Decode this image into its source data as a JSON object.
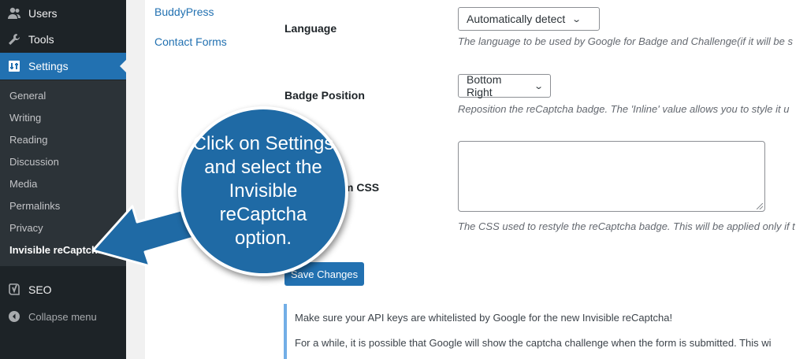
{
  "sidebar": {
    "top_items": [
      {
        "label": "Users",
        "icon": "users-icon"
      },
      {
        "label": "Tools",
        "icon": "tools-icon"
      },
      {
        "label": "Settings",
        "icon": "settings-icon"
      }
    ],
    "submenu": [
      "General",
      "Writing",
      "Reading",
      "Discussion",
      "Media",
      "Permalinks",
      "Privacy",
      "Invisible reCaptcha"
    ],
    "seo_label": "SEO",
    "collapse_label": "Collapse menu"
  },
  "nav": {
    "links": [
      "BuddyPress",
      "Contact Forms"
    ]
  },
  "form": {
    "language": {
      "label": "Language",
      "value": "Automatically detect",
      "desc": "The language to be used by Google for Badge and Challenge(if it will be s"
    },
    "badge": {
      "label": "Badge Position",
      "value": "Bottom Right",
      "desc": "Reposition the reCaptcha badge. The 'Inline' value allows you to style it u"
    },
    "css": {
      "label_fragment": "m CSS",
      "desc": "The CSS used to restyle the reCaptcha badge. This will be applied only if t"
    },
    "save_label": "Save Changes"
  },
  "notice": {
    "line1": "Make sure your API keys are whitelisted by Google for the new Invisible reCaptcha!",
    "line2": "For a while, it is possible that Google will show the captcha challenge when the form is submitted. This wi"
  },
  "callout": {
    "text": "Click on Settings and select the Invisible reCaptcha option."
  },
  "colors": {
    "admin_bar": "#1d2327",
    "accent": "#2271b1",
    "callout": "#1f6aa5"
  }
}
